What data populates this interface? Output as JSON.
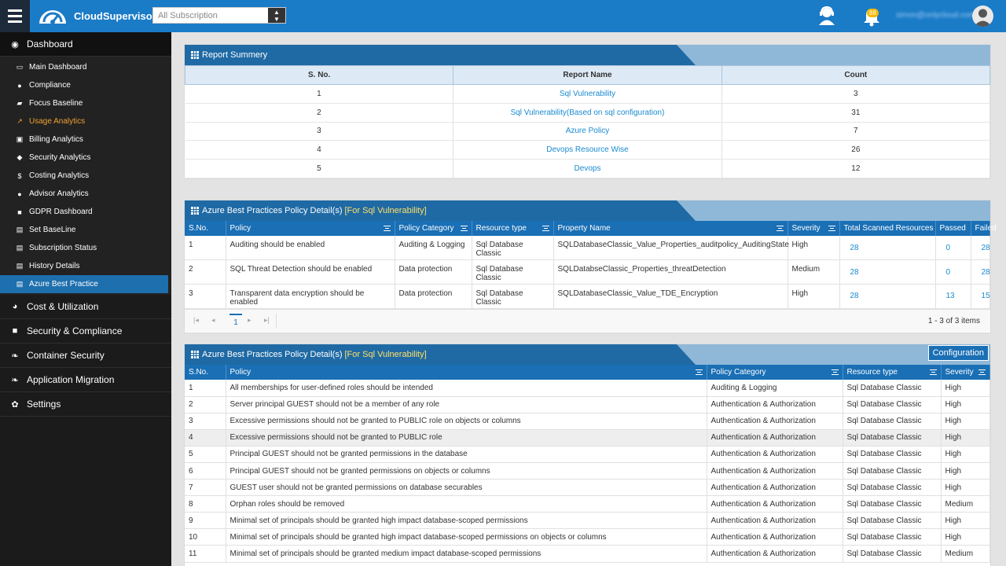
{
  "header": {
    "brand": "CloudSupervisor",
    "brand_mark": "®",
    "subscription_placeholder": "All Subscription",
    "notification_count": "88",
    "user_email": "simon@onlycloud.com"
  },
  "sidebar": {
    "dashboard_label": "Dashboard",
    "submenu": [
      {
        "label": "Main Dashboard",
        "icon": "monitor-icon"
      },
      {
        "label": "Compliance",
        "icon": "users-icon"
      },
      {
        "label": "Focus Baseline",
        "icon": "car-icon"
      },
      {
        "label": "Usage Analytics",
        "icon": "line-chart-icon"
      },
      {
        "label": "Billing Analytics",
        "icon": "money-icon"
      },
      {
        "label": "Security Analytics",
        "icon": "shield-icon"
      },
      {
        "label": "Costing Analytics",
        "icon": "dollar-icon"
      },
      {
        "label": "Advisor Analytics",
        "icon": "user-lock-icon"
      },
      {
        "label": "GDPR Dashboard",
        "icon": "lock-icon"
      },
      {
        "label": "Set BaseLine",
        "icon": "file-icon"
      },
      {
        "label": "Subscription Status",
        "icon": "file-icon"
      },
      {
        "label": "History Details",
        "icon": "file-icon"
      },
      {
        "label": "Azure Best Practice",
        "icon": "file-icon"
      }
    ],
    "sections": [
      {
        "label": "Cost & Utilization",
        "icon": "pie-chart-icon"
      },
      {
        "label": "Security & Compliance",
        "icon": "lock-icon"
      },
      {
        "label": "Container Security",
        "icon": "leaf-icon"
      },
      {
        "label": "Application Migration",
        "icon": "leaf-icon"
      },
      {
        "label": "Settings",
        "icon": "gear-icon"
      }
    ]
  },
  "report_summary": {
    "title": "Report Summery",
    "headers": [
      "S. No.",
      "Report Name",
      "Count"
    ],
    "rows": [
      {
        "sno": "1",
        "name": "Sql Vulnerability",
        "count": "3"
      },
      {
        "sno": "2",
        "name": "Sql Vulnerability(Based on sql configuration)",
        "count": "31"
      },
      {
        "sno": "3",
        "name": "Azure Policy",
        "count": "7"
      },
      {
        "sno": "4",
        "name": "Devops Resource Wise",
        "count": "26"
      },
      {
        "sno": "5",
        "name": "Devops",
        "count": "12"
      }
    ]
  },
  "policy_detail": {
    "title": "Azure Best Practices Policy Detail(s)",
    "highlight": "[For Sql Vulnerability]",
    "headers": [
      "S.No.",
      "Policy",
      "Policy Category",
      "Resource type",
      "Property Name",
      "Severity",
      "Total Scanned Resources",
      "Passed",
      "Failed"
    ],
    "rows": [
      {
        "sno": "1",
        "policy": "Auditing should be enabled",
        "category": "Auditing & Logging",
        "resource": "Sql Database Classic",
        "property": "SQLDatabaseClassic_Value_Properties_auditpolicy_AuditingState",
        "severity": "High",
        "total": "28",
        "passed": "0",
        "failed": "28"
      },
      {
        "sno": "2",
        "policy": "SQL Threat Detection should be enabled",
        "category": "Data protection",
        "resource": "Sql Database Classic",
        "property": "SQLDatabseClassic_Properties_threatDetection",
        "severity": "Medium",
        "total": "28",
        "passed": "0",
        "failed": "28"
      },
      {
        "sno": "3",
        "policy": "Transparent data encryption should be enabled",
        "category": "Data protection",
        "resource": "Sql Database Classic",
        "property": "SQLDatabaseClassic_Value_TDE_Encryption",
        "severity": "High",
        "total": "28",
        "passed": "13",
        "failed": "15"
      }
    ],
    "pager": {
      "current_page": "1",
      "items_text": "1 - 3 of 3 items"
    }
  },
  "policy_detail_2": {
    "title": "Azure Best Practices Policy Detail(s)",
    "highlight": "[For Sql Vulnerability]",
    "config_button": "Configuration",
    "headers": [
      "S.No.",
      "Policy",
      "Policy Category",
      "Resource type",
      "Severity"
    ],
    "rows": [
      {
        "sno": "1",
        "policy": "All memberships for user-defined roles should be intended",
        "category": "Auditing & Logging",
        "resource": "Sql Database Classic",
        "severity": "High"
      },
      {
        "sno": "2",
        "policy": "Server principal GUEST should not be a member of any role",
        "category": "Authentication & Authorization",
        "resource": "Sql Database Classic",
        "severity": "High"
      },
      {
        "sno": "3",
        "policy": "Excessive permissions should not be granted to PUBLIC role on objects or columns",
        "category": "Authentication & Authorization",
        "resource": "Sql Database Classic",
        "severity": "High"
      },
      {
        "sno": "4",
        "policy": "Excessive permissions should not be granted to PUBLIC role",
        "category": "Authentication & Authorization",
        "resource": "Sql Database Classic",
        "severity": "High"
      },
      {
        "sno": "5",
        "policy": "Principal GUEST should not be granted permissions in the database",
        "category": "Authentication & Authorization",
        "resource": "Sql Database Classic",
        "severity": "High"
      },
      {
        "sno": "6",
        "policy": "Principal GUEST should not be granted permissions on objects or columns",
        "category": "Authentication & Authorization",
        "resource": "Sql Database Classic",
        "severity": "High"
      },
      {
        "sno": "7",
        "policy": "GUEST user should not be granted permissions on database securables",
        "category": "Authentication & Authorization",
        "resource": "Sql Database Classic",
        "severity": "High"
      },
      {
        "sno": "8",
        "policy": "Orphan roles should be removed",
        "category": "Authentication & Authorization",
        "resource": "Sql Database Classic",
        "severity": "Medium"
      },
      {
        "sno": "9",
        "policy": "Minimal set of principals should be granted high impact database-scoped permissions",
        "category": "Authentication & Authorization",
        "resource": "Sql Database Classic",
        "severity": "High"
      },
      {
        "sno": "10",
        "policy": "Minimal set of principals should be granted high impact database-scoped permissions on objects or columns",
        "category": "Authentication & Authorization",
        "resource": "Sql Database Classic",
        "severity": "High"
      },
      {
        "sno": "11",
        "policy": "Minimal set of principals should be granted medium impact database-scoped permissions",
        "category": "Authentication & Authorization",
        "resource": "Sql Database Classic",
        "severity": "Medium"
      }
    ]
  },
  "colors": {
    "topbar": "#1a7bc7",
    "sidebar": "#1b1b1b",
    "table_header": "#1a6fb5",
    "link": "#1a8ad0",
    "highlight": "#ffe066",
    "active_menu": "#f0a030"
  }
}
